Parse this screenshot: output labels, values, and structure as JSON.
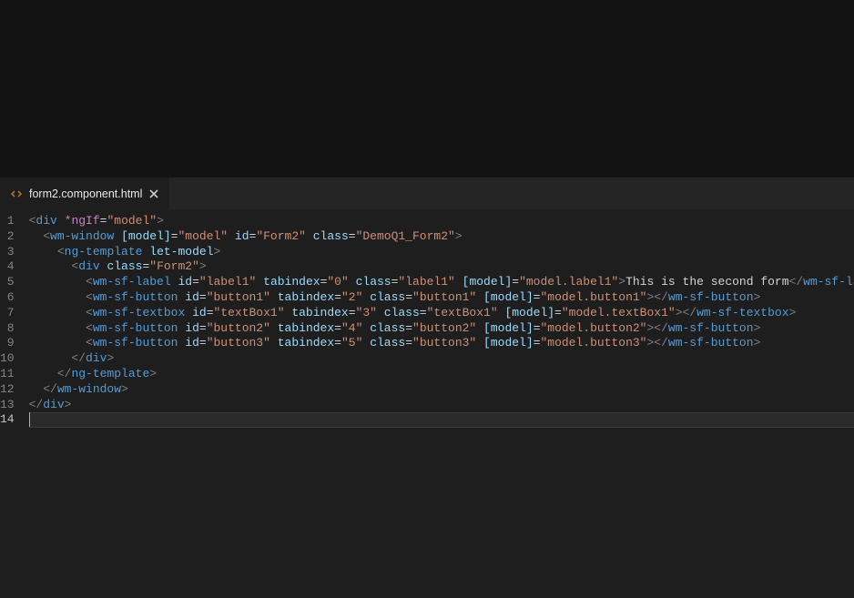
{
  "tab": {
    "filename": "form2.component.html"
  },
  "gutter": {
    "lines": [
      "1",
      "2",
      "3",
      "4",
      "5",
      "6",
      "7",
      "8",
      "9",
      "10",
      "11",
      "12",
      "13",
      "14"
    ],
    "active": 14
  },
  "code": {
    "lines": [
      [
        {
          "c": "p",
          "t": "<"
        },
        {
          "c": "tg",
          "t": "div"
        },
        {
          "c": "tx",
          "t": " "
        },
        {
          "c": "kw",
          "t": "*ngIf"
        },
        {
          "c": "tx",
          "t": "="
        },
        {
          "c": "st",
          "t": "\"model\""
        },
        {
          "c": "p",
          "t": ">"
        }
      ],
      [
        {
          "c": "tx",
          "t": "  "
        },
        {
          "c": "p",
          "t": "<"
        },
        {
          "c": "tg",
          "t": "wm-window"
        },
        {
          "c": "tx",
          "t": " "
        },
        {
          "c": "at",
          "t": "[model]"
        },
        {
          "c": "tx",
          "t": "="
        },
        {
          "c": "st",
          "t": "\"model\""
        },
        {
          "c": "tx",
          "t": " "
        },
        {
          "c": "at",
          "t": "id"
        },
        {
          "c": "tx",
          "t": "="
        },
        {
          "c": "st",
          "t": "\"Form2\""
        },
        {
          "c": "tx",
          "t": " "
        },
        {
          "c": "at",
          "t": "class"
        },
        {
          "c": "tx",
          "t": "="
        },
        {
          "c": "st",
          "t": "\"DemoQ1_Form2\""
        },
        {
          "c": "p",
          "t": ">"
        }
      ],
      [
        {
          "c": "tx",
          "t": "    "
        },
        {
          "c": "p",
          "t": "<"
        },
        {
          "c": "tg",
          "t": "ng-template"
        },
        {
          "c": "tx",
          "t": " "
        },
        {
          "c": "at",
          "t": "let-model"
        },
        {
          "c": "p",
          "t": ">"
        }
      ],
      [
        {
          "c": "tx",
          "t": "      "
        },
        {
          "c": "p",
          "t": "<"
        },
        {
          "c": "tg",
          "t": "div"
        },
        {
          "c": "tx",
          "t": " "
        },
        {
          "c": "at",
          "t": "class"
        },
        {
          "c": "tx",
          "t": "="
        },
        {
          "c": "st",
          "t": "\"Form2\""
        },
        {
          "c": "p",
          "t": ">"
        }
      ],
      [
        {
          "c": "tx",
          "t": "        "
        },
        {
          "c": "p",
          "t": "<"
        },
        {
          "c": "tg",
          "t": "wm-sf-label"
        },
        {
          "c": "tx",
          "t": " "
        },
        {
          "c": "at",
          "t": "id"
        },
        {
          "c": "tx",
          "t": "="
        },
        {
          "c": "st",
          "t": "\"label1\""
        },
        {
          "c": "tx",
          "t": " "
        },
        {
          "c": "at",
          "t": "tabindex"
        },
        {
          "c": "tx",
          "t": "="
        },
        {
          "c": "st",
          "t": "\"0\""
        },
        {
          "c": "tx",
          "t": " "
        },
        {
          "c": "at",
          "t": "class"
        },
        {
          "c": "tx",
          "t": "="
        },
        {
          "c": "st",
          "t": "\"label1\""
        },
        {
          "c": "tx",
          "t": " "
        },
        {
          "c": "at",
          "t": "[model]"
        },
        {
          "c": "tx",
          "t": "="
        },
        {
          "c": "st",
          "t": "\"model.label1\""
        },
        {
          "c": "p",
          "t": ">"
        },
        {
          "c": "tx",
          "t": "This is the second form"
        },
        {
          "c": "p",
          "t": "</"
        },
        {
          "c": "tg",
          "t": "wm-sf-label"
        },
        {
          "c": "p",
          "t": ">"
        }
      ],
      [
        {
          "c": "tx",
          "t": "        "
        },
        {
          "c": "p",
          "t": "<"
        },
        {
          "c": "tg",
          "t": "wm-sf-button"
        },
        {
          "c": "tx",
          "t": " "
        },
        {
          "c": "at",
          "t": "id"
        },
        {
          "c": "tx",
          "t": "="
        },
        {
          "c": "st",
          "t": "\"button1\""
        },
        {
          "c": "tx",
          "t": " "
        },
        {
          "c": "at",
          "t": "tabindex"
        },
        {
          "c": "tx",
          "t": "="
        },
        {
          "c": "st",
          "t": "\"2\""
        },
        {
          "c": "tx",
          "t": " "
        },
        {
          "c": "at",
          "t": "class"
        },
        {
          "c": "tx",
          "t": "="
        },
        {
          "c": "st",
          "t": "\"button1\""
        },
        {
          "c": "tx",
          "t": " "
        },
        {
          "c": "at",
          "t": "[model]"
        },
        {
          "c": "tx",
          "t": "="
        },
        {
          "c": "st",
          "t": "\"model.button1\""
        },
        {
          "c": "p",
          "t": "></"
        },
        {
          "c": "tg",
          "t": "wm-sf-button"
        },
        {
          "c": "p",
          "t": ">"
        }
      ],
      [
        {
          "c": "tx",
          "t": "        "
        },
        {
          "c": "p",
          "t": "<"
        },
        {
          "c": "tg",
          "t": "wm-sf-textbox"
        },
        {
          "c": "tx",
          "t": " "
        },
        {
          "c": "at",
          "t": "id"
        },
        {
          "c": "tx",
          "t": "="
        },
        {
          "c": "st",
          "t": "\"textBox1\""
        },
        {
          "c": "tx",
          "t": " "
        },
        {
          "c": "at",
          "t": "tabindex"
        },
        {
          "c": "tx",
          "t": "="
        },
        {
          "c": "st",
          "t": "\"3\""
        },
        {
          "c": "tx",
          "t": " "
        },
        {
          "c": "at",
          "t": "class"
        },
        {
          "c": "tx",
          "t": "="
        },
        {
          "c": "st",
          "t": "\"textBox1\""
        },
        {
          "c": "tx",
          "t": " "
        },
        {
          "c": "at",
          "t": "[model]"
        },
        {
          "c": "tx",
          "t": "="
        },
        {
          "c": "st",
          "t": "\"model.textBox1\""
        },
        {
          "c": "p",
          "t": "></"
        },
        {
          "c": "tg",
          "t": "wm-sf-textbox"
        },
        {
          "c": "p",
          "t": ">"
        }
      ],
      [
        {
          "c": "tx",
          "t": "        "
        },
        {
          "c": "p",
          "t": "<"
        },
        {
          "c": "tg",
          "t": "wm-sf-button"
        },
        {
          "c": "tx",
          "t": " "
        },
        {
          "c": "at",
          "t": "id"
        },
        {
          "c": "tx",
          "t": "="
        },
        {
          "c": "st",
          "t": "\"button2\""
        },
        {
          "c": "tx",
          "t": " "
        },
        {
          "c": "at",
          "t": "tabindex"
        },
        {
          "c": "tx",
          "t": "="
        },
        {
          "c": "st",
          "t": "\"4\""
        },
        {
          "c": "tx",
          "t": " "
        },
        {
          "c": "at",
          "t": "class"
        },
        {
          "c": "tx",
          "t": "="
        },
        {
          "c": "st",
          "t": "\"button2\""
        },
        {
          "c": "tx",
          "t": " "
        },
        {
          "c": "at",
          "t": "[model]"
        },
        {
          "c": "tx",
          "t": "="
        },
        {
          "c": "st",
          "t": "\"model.button2\""
        },
        {
          "c": "p",
          "t": "></"
        },
        {
          "c": "tg",
          "t": "wm-sf-button"
        },
        {
          "c": "p",
          "t": ">"
        }
      ],
      [
        {
          "c": "tx",
          "t": "        "
        },
        {
          "c": "p",
          "t": "<"
        },
        {
          "c": "tg",
          "t": "wm-sf-button"
        },
        {
          "c": "tx",
          "t": " "
        },
        {
          "c": "at",
          "t": "id"
        },
        {
          "c": "tx",
          "t": "="
        },
        {
          "c": "st",
          "t": "\"button3\""
        },
        {
          "c": "tx",
          "t": " "
        },
        {
          "c": "at",
          "t": "tabindex"
        },
        {
          "c": "tx",
          "t": "="
        },
        {
          "c": "st",
          "t": "\"5\""
        },
        {
          "c": "tx",
          "t": " "
        },
        {
          "c": "at",
          "t": "class"
        },
        {
          "c": "tx",
          "t": "="
        },
        {
          "c": "st",
          "t": "\"button3\""
        },
        {
          "c": "tx",
          "t": " "
        },
        {
          "c": "at",
          "t": "[model]"
        },
        {
          "c": "tx",
          "t": "="
        },
        {
          "c": "st",
          "t": "\"model.button3\""
        },
        {
          "c": "p",
          "t": "></"
        },
        {
          "c": "tg",
          "t": "wm-sf-button"
        },
        {
          "c": "p",
          "t": ">"
        }
      ],
      [
        {
          "c": "tx",
          "t": "      "
        },
        {
          "c": "p",
          "t": "</"
        },
        {
          "c": "tg",
          "t": "div"
        },
        {
          "c": "p",
          "t": ">"
        }
      ],
      [
        {
          "c": "tx",
          "t": "    "
        },
        {
          "c": "p",
          "t": "</"
        },
        {
          "c": "tg",
          "t": "ng-template"
        },
        {
          "c": "p",
          "t": ">"
        }
      ],
      [
        {
          "c": "tx",
          "t": "  "
        },
        {
          "c": "p",
          "t": "</"
        },
        {
          "c": "tg",
          "t": "wm-window"
        },
        {
          "c": "p",
          "t": ">"
        }
      ],
      [
        {
          "c": "p",
          "t": "</"
        },
        {
          "c": "tg",
          "t": "div"
        },
        {
          "c": "p",
          "t": ">"
        }
      ],
      []
    ],
    "highlighted_line": 14
  }
}
